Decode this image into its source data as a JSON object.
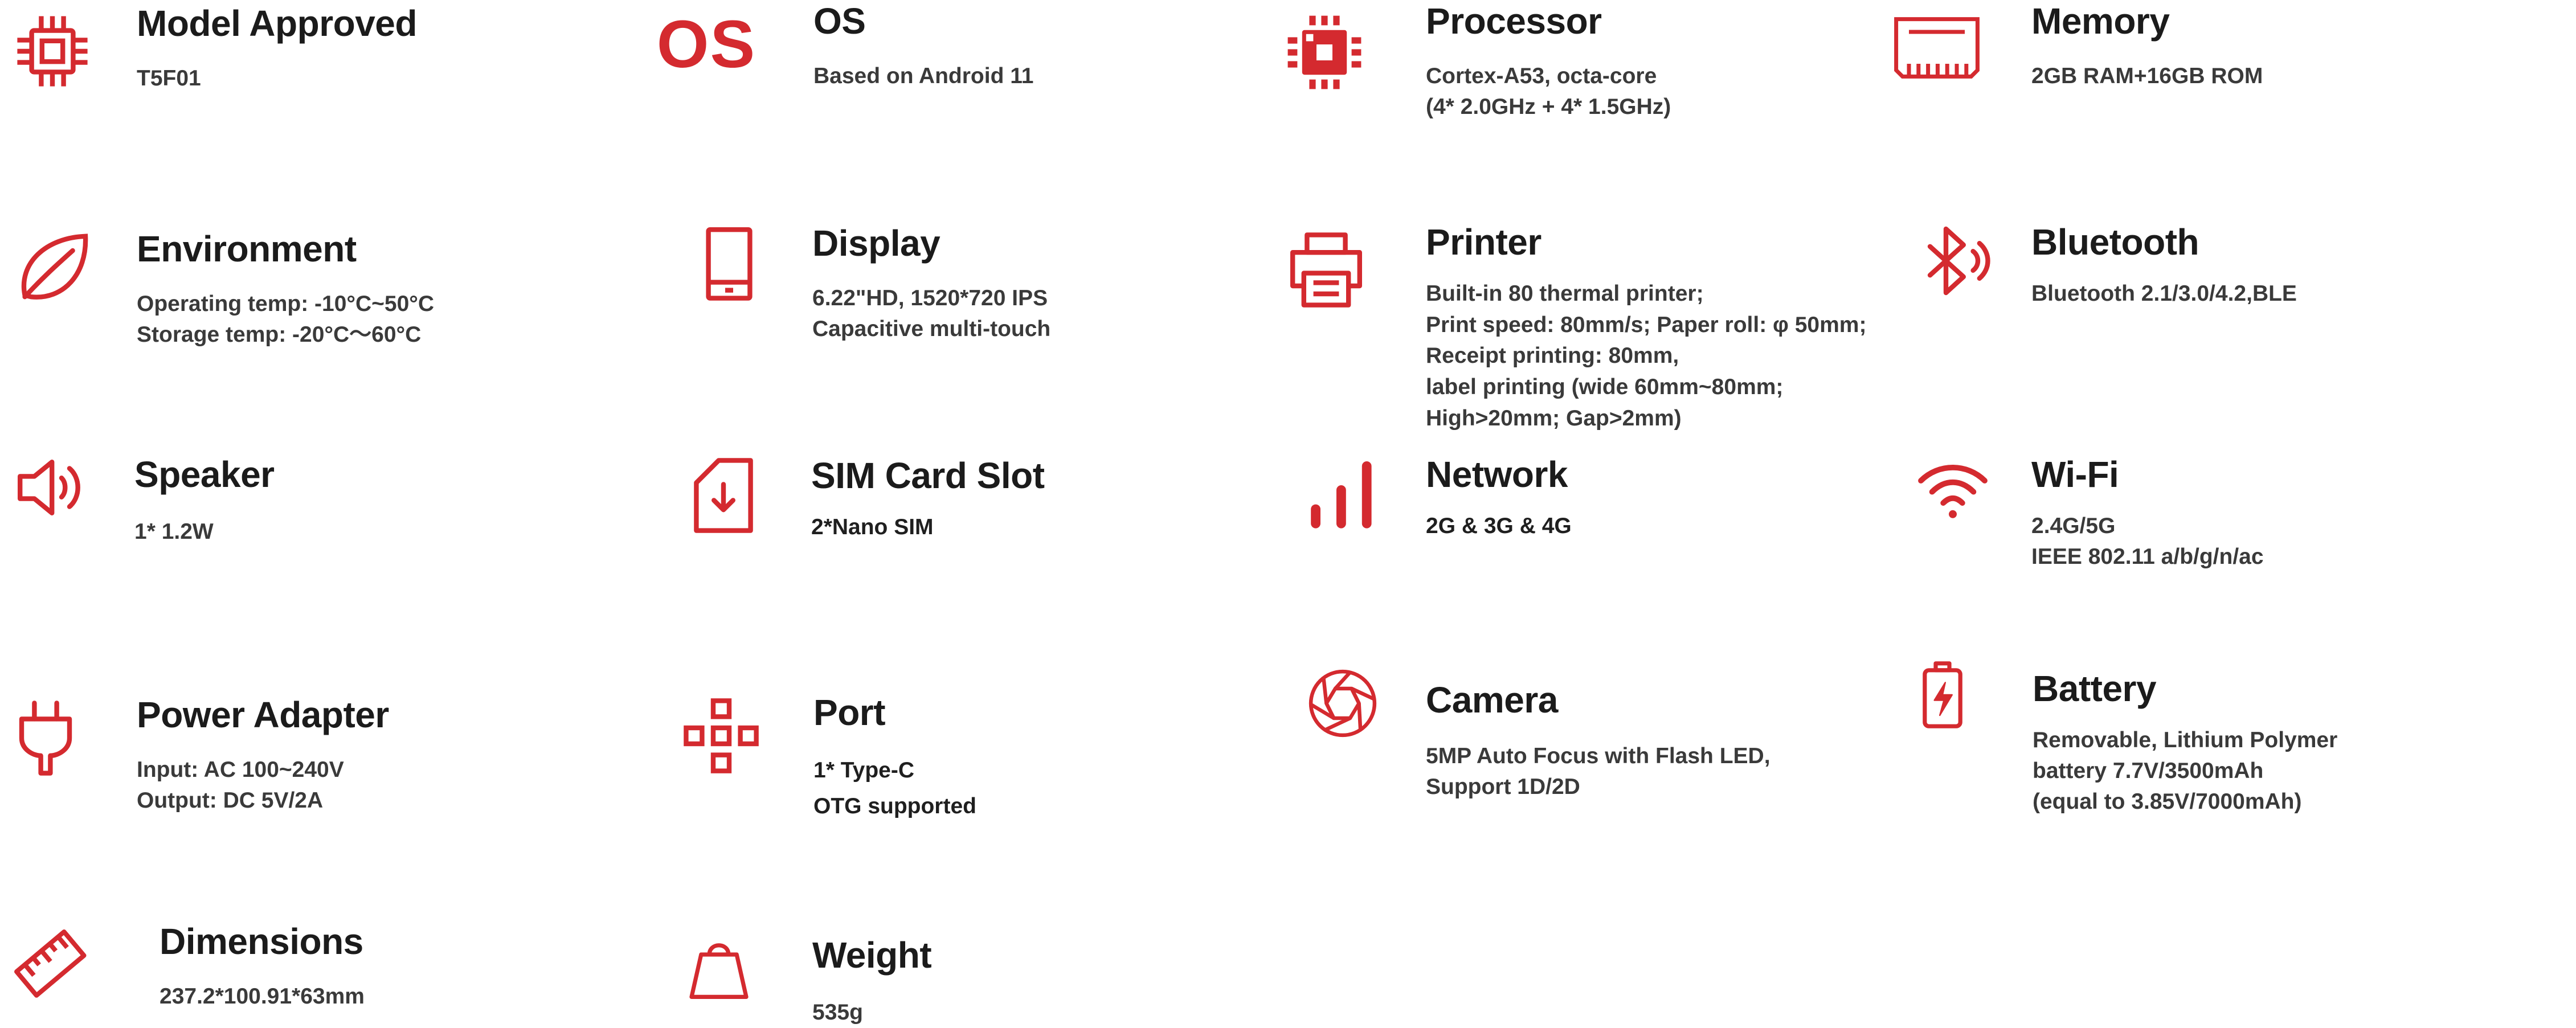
{
  "colors": {
    "accent": "#d42a2f",
    "title": "#1b1b1b",
    "text": "#3a3a3a",
    "background": "#ffffff"
  },
  "specs": [
    {
      "id": "model",
      "icon": "chip-icon",
      "title": "Model Approved",
      "lines": [
        "T5F01"
      ]
    },
    {
      "id": "os",
      "icon": "os-text-icon",
      "icon_text": "OS",
      "title": "OS",
      "lines": [
        "Based on Android 11"
      ]
    },
    {
      "id": "processor",
      "icon": "processor-icon",
      "title": "Processor",
      "lines": [
        "Cortex-A53, octa-core",
        "(4* 2.0GHz + 4* 1.5GHz)"
      ]
    },
    {
      "id": "memory",
      "icon": "memory-card-icon",
      "title": "Memory",
      "lines": [
        "2GB RAM+16GB ROM"
      ]
    },
    {
      "id": "environment",
      "icon": "leaf-icon",
      "title": "Environment",
      "lines": [
        "Operating temp: -10°C~50°C",
        "Storage temp: -20°C～60°C"
      ]
    },
    {
      "id": "display",
      "icon": "phone-icon",
      "title": "Display",
      "lines": [
        "6.22\"HD,   1520*720 IPS",
        "Capacitive multi-touch"
      ]
    },
    {
      "id": "printer",
      "icon": "printer-icon",
      "title": "Printer",
      "lines": [
        "Built-in 80 thermal printer;",
        "Print speed: 80mm/s; Paper roll: φ 50mm;",
        "Receipt printing: 80mm,",
        "label printing (wide 60mm~80mm;",
        "High>20mm; Gap>2mm)"
      ]
    },
    {
      "id": "bluetooth",
      "icon": "bluetooth-icon",
      "title": "Bluetooth",
      "lines": [
        "Bluetooth 2.1/3.0/4.2,BLE"
      ]
    },
    {
      "id": "speaker",
      "icon": "speaker-icon",
      "title": "Speaker",
      "lines": [
        "1* 1.2W"
      ]
    },
    {
      "id": "sim",
      "icon": "sim-card-icon",
      "title": "SIM Card Slot",
      "lines": [
        "2*Nano SIM"
      ]
    },
    {
      "id": "network",
      "icon": "signal-bars-icon",
      "title": "Network",
      "lines": [
        "2G & 3G & 4G"
      ]
    },
    {
      "id": "wifi",
      "icon": "wifi-icon",
      "title": "Wi-Fi",
      "lines": [
        "2.4G/5G",
        "IEEE 802.11 a/b/g/n/ac"
      ]
    },
    {
      "id": "power",
      "icon": "plug-icon",
      "title": "Power Adapter",
      "lines": [
        "Input: AC 100~240V",
        "Output: DC 5V/2A"
      ]
    },
    {
      "id": "port",
      "icon": "port-icon",
      "title": "Port",
      "lines": [
        "1* Type-C",
        "OTG supported"
      ]
    },
    {
      "id": "camera",
      "icon": "camera-aperture-icon",
      "title": "Camera",
      "lines": [
        "5MP Auto Focus with Flash LED,",
        "Support 1D/2D"
      ]
    },
    {
      "id": "battery",
      "icon": "battery-icon",
      "title": "Battery",
      "lines": [
        "Removable, Lithium Polymer",
        "battery 7.7V/3500mAh",
        "(equal to 3.85V/7000mAh)"
      ]
    },
    {
      "id": "dimensions",
      "icon": "ruler-icon",
      "title": "Dimensions",
      "lines": [
        "237.2*100.91*63mm"
      ]
    },
    {
      "id": "weight",
      "icon": "weight-icon",
      "title": "Weight",
      "lines": [
        "535g"
      ]
    }
  ]
}
